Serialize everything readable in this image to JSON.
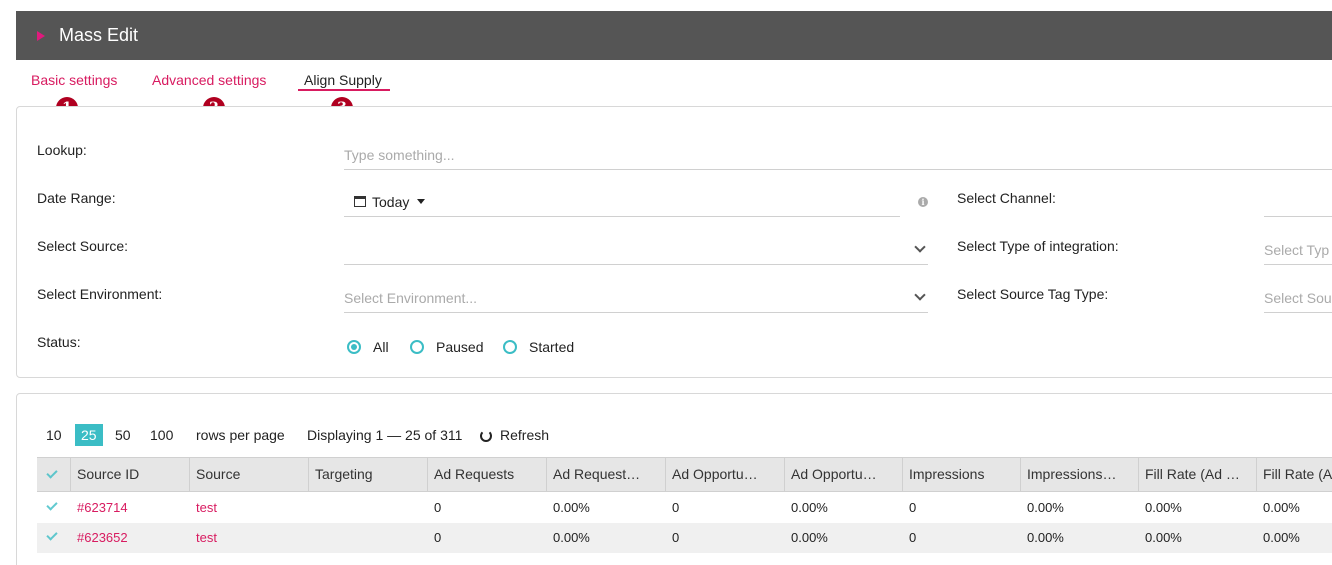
{
  "header": {
    "title": "Mass Edit"
  },
  "tabs": [
    {
      "label": "Basic settings",
      "badge": "1"
    },
    {
      "label": "Advanced settings",
      "badge": "2"
    },
    {
      "label": "Align Supply",
      "badge": "3"
    }
  ],
  "form": {
    "lookup_label": "Lookup:",
    "lookup_placeholder": "Type something...",
    "date_range_label": "Date Range:",
    "date_range_value": "Today",
    "source_label": "Select Source:",
    "environment_label": "Select Environment:",
    "environment_placeholder": "Select Environment...",
    "status_label": "Status:",
    "status_options": [
      "All",
      "Paused",
      "Started"
    ],
    "status_selected": "All",
    "channel_label": "Select Channel:",
    "integration_label": "Select Type of integration:",
    "integration_placeholder": "Select Typ",
    "source_tag_label": "Select Source Tag Type:",
    "source_tag_placeholder": "Select Sou"
  },
  "pagination": {
    "sizes": [
      "10",
      "25",
      "50",
      "100"
    ],
    "selected": "25",
    "rows_per_page": "rows per page",
    "displaying": "Displaying 1 — 25 of 311",
    "refresh": "Refresh"
  },
  "table": {
    "columns": [
      "Source ID",
      "Source",
      "Targeting",
      "Ad Requests",
      "Ad Request…",
      "Ad Opportu…",
      "Ad Opportu…",
      "Impressions",
      "Impressions…",
      "Fill Rate (Ad …",
      "Fill Rate (Ad"
    ],
    "rows": [
      [
        "#623714",
        "test",
        "",
        "0",
        "0.00%",
        "0",
        "0.00%",
        "0",
        "0.00%",
        "0.00%",
        "0.00%"
      ],
      [
        "#623652",
        "test",
        "",
        "0",
        "0.00%",
        "0",
        "0.00%",
        "0",
        "0.00%",
        "0.00%",
        "0.00%"
      ]
    ]
  },
  "colors": {
    "accent": "#d81b60",
    "teal": "#3bbdc5",
    "header_bg": "#555555"
  }
}
